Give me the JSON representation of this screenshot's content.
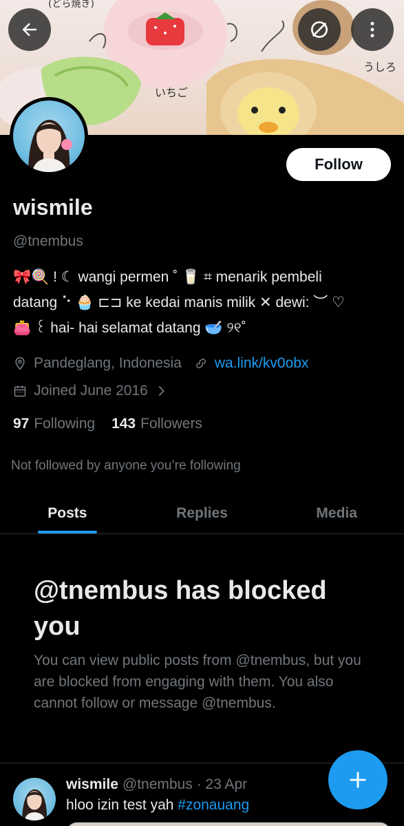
{
  "header": {
    "back_icon": "arrow-left-icon",
    "unmute_icon": "bell-slash-icon",
    "more_icon": "more-vertical-icon",
    "banner_text_left": "(どら焼き)",
    "banner_text_strawberry": "いちご",
    "banner_text_back": "うしろ"
  },
  "profile": {
    "follow_label": "Follow",
    "name": "wismile",
    "handle": "@tnembus",
    "bio_lines": [
      "🎀🍭 ! ☾ wangi permen ˚ 🥛 ⌗  menarik pembeli",
      "datang ⠑ 🧁 ⊏⊐ ke kedai manis milik ✕ dewi: ︶ ♡",
      "👛 ꒰ hai- hai selamat datang 🥣 ୨୧˚"
    ],
    "location": "Pandeglang, Indonesia",
    "link": "wa.link/kv0obx",
    "joined": "Joined June 2016",
    "following_count": "97",
    "following_label": "Following",
    "followers_count": "143",
    "followers_label": "Followers",
    "not_followed": "Not followed by anyone you’re following"
  },
  "tabs": [
    {
      "label": "Posts",
      "active": true
    },
    {
      "label": "Replies",
      "active": false
    },
    {
      "label": "Media",
      "active": false
    }
  ],
  "blocked": {
    "title": "@tnembus has blocked you",
    "message": "You can view public posts from @tnembus, but you are blocked from engaging with them. You also cannot follow or message @tnembus."
  },
  "post": {
    "name": "wismile",
    "meta": "@tnembus · 23 Apr",
    "text": "hloo izin test yah ",
    "hashtag": "#zonauang"
  },
  "colors": {
    "accent": "#1d9bf0",
    "background": "#000000",
    "text_primary": "#e7e9ea",
    "text_secondary": "#71767b"
  }
}
